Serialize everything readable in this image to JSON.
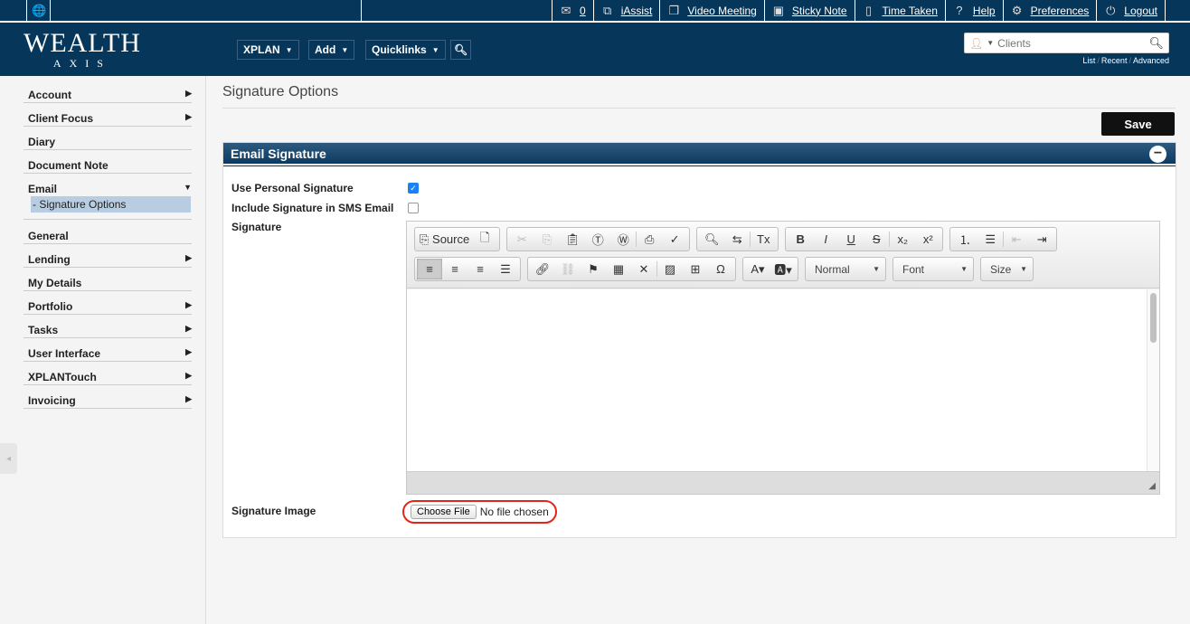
{
  "topbar": {
    "mail_count": "0",
    "items": [
      {
        "icon": "iassist-icon",
        "glyph": "⧉",
        "label": "iAssist"
      },
      {
        "icon": "video-meeting-icon",
        "glyph": "❐",
        "label": "Video Meeting"
      },
      {
        "icon": "sticky-note-icon",
        "glyph": "▣",
        "label": "Sticky Note"
      },
      {
        "icon": "time-taken-icon",
        "glyph": "▯",
        "label": "Time Taken"
      },
      {
        "icon": "help-icon",
        "glyph": "?",
        "label": "Help"
      },
      {
        "icon": "gear-icon",
        "glyph": "⚙",
        "label": "Preferences"
      },
      {
        "icon": "power-icon",
        "glyph": "⏻",
        "label": "Logout"
      }
    ]
  },
  "logo": {
    "line1": "WEALTH",
    "line2": "AXIS"
  },
  "nav": {
    "xplan": "XPLAN",
    "add": "Add",
    "quicklinks": "Quicklinks"
  },
  "search": {
    "placeholder": "Clients",
    "links": [
      "List",
      "Recent",
      "Advanced"
    ]
  },
  "sidebar": {
    "items": [
      {
        "label": "Account",
        "arrow": "▶"
      },
      {
        "label": "Client Focus",
        "arrow": "▶"
      },
      {
        "label": "Diary",
        "arrow": ""
      },
      {
        "label": "Document Note",
        "arrow": ""
      },
      {
        "label": "Email",
        "arrow": "▼"
      },
      {
        "label": "General",
        "arrow": ""
      },
      {
        "label": "Lending",
        "arrow": "▶"
      },
      {
        "label": "My Details",
        "arrow": ""
      },
      {
        "label": "Portfolio",
        "arrow": "▶"
      },
      {
        "label": "Tasks",
        "arrow": "▶"
      },
      {
        "label": "User Interface",
        "arrow": "▶"
      },
      {
        "label": "XPLANTouch",
        "arrow": "▶"
      },
      {
        "label": "Invoicing",
        "arrow": "▶"
      }
    ],
    "sub_item": "- Signature Options"
  },
  "page": {
    "title": "Signature Options",
    "save": "Save"
  },
  "panel": {
    "title": "Email Signature",
    "use_personal_label": "Use Personal Signature",
    "use_personal_checked": true,
    "include_sms_label": "Include Signature in SMS Email",
    "include_sms_checked": false,
    "signature_label": "Signature",
    "image_label": "Signature Image",
    "choose_file": "Choose File",
    "no_file": "No file chosen"
  },
  "editor": {
    "source": "Source",
    "combos": [
      "Normal",
      "Font",
      "Size"
    ]
  }
}
